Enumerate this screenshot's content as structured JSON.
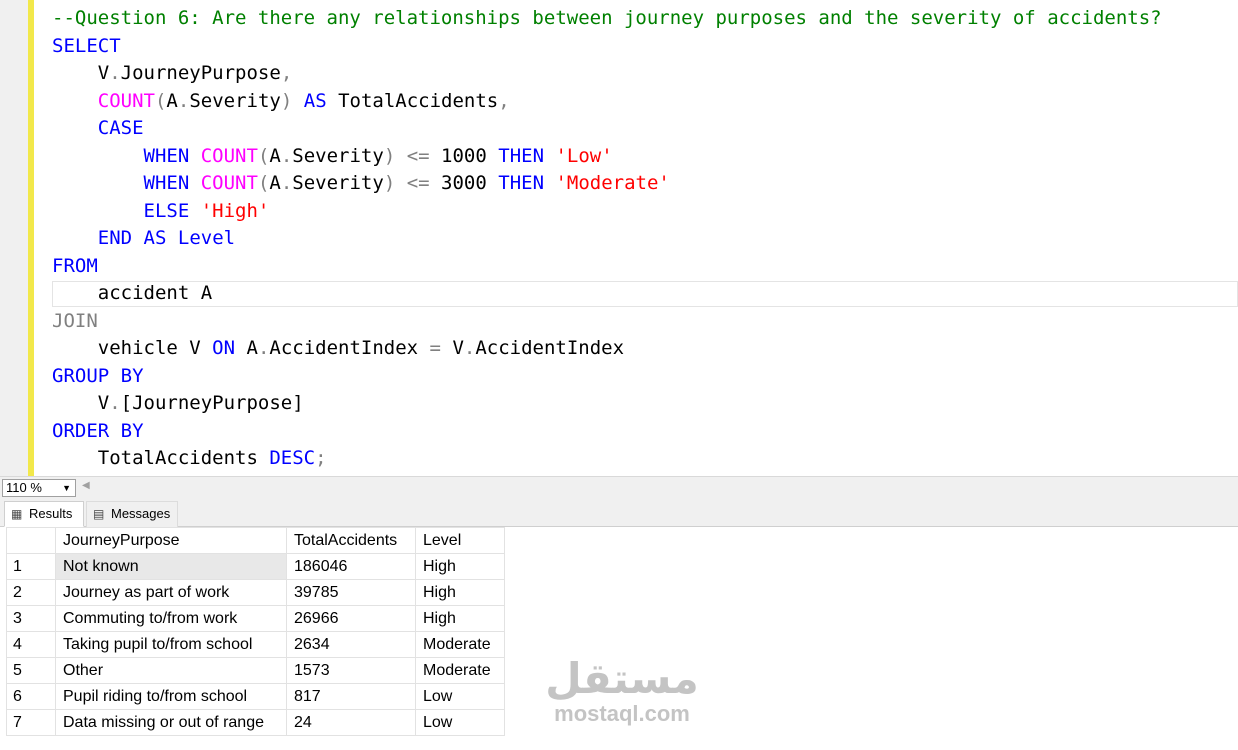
{
  "editor": {
    "lines": [
      [
        {
          "t": "--Question 6: Are there any relationships between journey purposes and the severity of accidents?",
          "c": "comment"
        }
      ],
      [
        {
          "t": "SELECT",
          "c": "keyword"
        }
      ],
      [
        {
          "t": "    V",
          "c": "plain"
        },
        {
          "t": ".",
          "c": "gray"
        },
        {
          "t": "JourneyPurpose",
          "c": "plain"
        },
        {
          "t": ",",
          "c": "gray"
        }
      ],
      [
        {
          "t": "    ",
          "c": "plain"
        },
        {
          "t": "COUNT",
          "c": "func"
        },
        {
          "t": "(",
          "c": "gray"
        },
        {
          "t": "A",
          "c": "plain"
        },
        {
          "t": ".",
          "c": "gray"
        },
        {
          "t": "Severity",
          "c": "plain"
        },
        {
          "t": ")",
          "c": "gray"
        },
        {
          "t": " ",
          "c": "plain"
        },
        {
          "t": "AS",
          "c": "keyword"
        },
        {
          "t": " TotalAccidents",
          "c": "plain"
        },
        {
          "t": ",",
          "c": "gray"
        }
      ],
      [
        {
          "t": "    ",
          "c": "plain"
        },
        {
          "t": "CASE",
          "c": "keyword"
        }
      ],
      [
        {
          "t": "        ",
          "c": "plain"
        },
        {
          "t": "WHEN",
          "c": "keyword"
        },
        {
          "t": " ",
          "c": "plain"
        },
        {
          "t": "COUNT",
          "c": "func"
        },
        {
          "t": "(",
          "c": "gray"
        },
        {
          "t": "A",
          "c": "plain"
        },
        {
          "t": ".",
          "c": "gray"
        },
        {
          "t": "Severity",
          "c": "plain"
        },
        {
          "t": ")",
          "c": "gray"
        },
        {
          "t": " ",
          "c": "plain"
        },
        {
          "t": "<=",
          "c": "gray"
        },
        {
          "t": " 1000 ",
          "c": "plain"
        },
        {
          "t": "THEN",
          "c": "keyword"
        },
        {
          "t": " ",
          "c": "plain"
        },
        {
          "t": "'Low'",
          "c": "string"
        }
      ],
      [
        {
          "t": "        ",
          "c": "plain"
        },
        {
          "t": "WHEN",
          "c": "keyword"
        },
        {
          "t": " ",
          "c": "plain"
        },
        {
          "t": "COUNT",
          "c": "func"
        },
        {
          "t": "(",
          "c": "gray"
        },
        {
          "t": "A",
          "c": "plain"
        },
        {
          "t": ".",
          "c": "gray"
        },
        {
          "t": "Severity",
          "c": "plain"
        },
        {
          "t": ")",
          "c": "gray"
        },
        {
          "t": " ",
          "c": "plain"
        },
        {
          "t": "<=",
          "c": "gray"
        },
        {
          "t": " 3000 ",
          "c": "plain"
        },
        {
          "t": "THEN",
          "c": "keyword"
        },
        {
          "t": " ",
          "c": "plain"
        },
        {
          "t": "'Moderate'",
          "c": "string"
        }
      ],
      [
        {
          "t": "        ",
          "c": "plain"
        },
        {
          "t": "ELSE",
          "c": "keyword"
        },
        {
          "t": " ",
          "c": "plain"
        },
        {
          "t": "'High'",
          "c": "string"
        }
      ],
      [
        {
          "t": "    ",
          "c": "plain"
        },
        {
          "t": "END",
          "c": "keyword"
        },
        {
          "t": " ",
          "c": "plain"
        },
        {
          "t": "AS",
          "c": "keyword"
        },
        {
          "t": " ",
          "c": "plain"
        },
        {
          "t": "Level",
          "c": "keyword"
        }
      ],
      [
        {
          "t": "FROM",
          "c": "keyword"
        }
      ],
      [
        {
          "t": "    accident A",
          "c": "plain"
        }
      ],
      [
        {
          "t": "JOIN",
          "c": "gray"
        }
      ],
      [
        {
          "t": "    vehicle V ",
          "c": "plain"
        },
        {
          "t": "ON",
          "c": "keyword"
        },
        {
          "t": " A",
          "c": "plain"
        },
        {
          "t": ".",
          "c": "gray"
        },
        {
          "t": "AccidentIndex ",
          "c": "plain"
        },
        {
          "t": "=",
          "c": "gray"
        },
        {
          "t": " V",
          "c": "plain"
        },
        {
          "t": ".",
          "c": "gray"
        },
        {
          "t": "AccidentIndex",
          "c": "plain"
        }
      ],
      [
        {
          "t": "GROUP",
          "c": "keyword"
        },
        {
          "t": " ",
          "c": "plain"
        },
        {
          "t": "BY",
          "c": "keyword"
        }
      ],
      [
        {
          "t": "    V",
          "c": "plain"
        },
        {
          "t": ".",
          "c": "gray"
        },
        {
          "t": "[JourneyPurpose]",
          "c": "plain"
        }
      ],
      [
        {
          "t": "ORDER",
          "c": "keyword"
        },
        {
          "t": " ",
          "c": "plain"
        },
        {
          "t": "BY",
          "c": "keyword"
        }
      ],
      [
        {
          "t": "    TotalAccidents ",
          "c": "plain"
        },
        {
          "t": "DESC",
          "c": "keyword"
        },
        {
          "t": ";",
          "c": "gray"
        }
      ]
    ]
  },
  "zoom": {
    "value": "110 %"
  },
  "tabs": {
    "results_label": "Results",
    "messages_label": "Messages"
  },
  "results": {
    "columns": [
      "JourneyPurpose",
      "TotalAccidents",
      "Level"
    ],
    "rows": [
      {
        "num": "1",
        "purpose": "Not known",
        "total": "186046",
        "level": "High"
      },
      {
        "num": "2",
        "purpose": "Journey as part of work",
        "total": "39785",
        "level": "High"
      },
      {
        "num": "3",
        "purpose": "Commuting to/from work",
        "total": "26966",
        "level": "High"
      },
      {
        "num": "4",
        "purpose": "Taking pupil to/from school",
        "total": "2634",
        "level": "Moderate"
      },
      {
        "num": "5",
        "purpose": "Other",
        "total": "1573",
        "level": "Moderate"
      },
      {
        "num": "6",
        "purpose": "Pupil riding to/from school",
        "total": "817",
        "level": "Low"
      },
      {
        "num": "7",
        "purpose": "Data missing or out of range",
        "total": "24",
        "level": "Low"
      }
    ]
  },
  "watermark": {
    "arabic": "مستقل",
    "latin": "mostaql.com"
  }
}
